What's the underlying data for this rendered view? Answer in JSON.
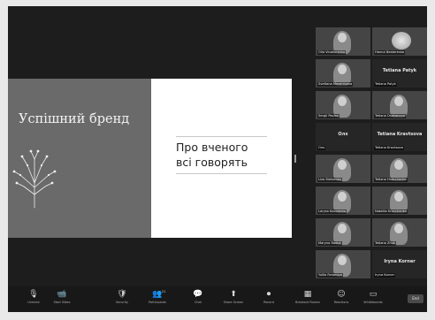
{
  "slide": {
    "title": "Успішний бренд",
    "body_lines": [
      "Про вченого",
      "всі говорять"
    ]
  },
  "gallery": {
    "tiles": [
      {
        "kind": "video",
        "label": "Olia Vinokurenko"
      },
      {
        "kind": "video",
        "label": "Hanna Nesterenko"
      },
      {
        "kind": "video",
        "label": "Svetlana Mezentseva"
      },
      {
        "kind": "name",
        "display": "Tetiana Patyk",
        "label": "Tetiana Patyk"
      },
      {
        "kind": "video",
        "label": "Sergii Pavlov"
      },
      {
        "kind": "video",
        "label": "Tetiana Osakanova"
      },
      {
        "kind": "name",
        "display": "Олх",
        "label": "Олх"
      },
      {
        "kind": "name",
        "display": "Tetiana Kravtsova",
        "label": "Tetiana Kravtsova"
      },
      {
        "kind": "video",
        "label": "Liza Stetsenko"
      },
      {
        "kind": "video",
        "label": "Tetiana Hrabchenko"
      },
      {
        "kind": "video",
        "label": "Larysa Kovalenko"
      },
      {
        "kind": "video",
        "label": "Nataliia Kravchenko"
      },
      {
        "kind": "video",
        "label": "Maryna Radok"
      },
      {
        "kind": "video",
        "label": "Tetiana Zhuk"
      },
      {
        "kind": "video",
        "label": "Yuliia Fedorova"
      },
      {
        "kind": "name",
        "display": "Iryna Korner",
        "label": "Iryna Korner"
      }
    ],
    "more": "⌄"
  },
  "toolbar": {
    "items": [
      {
        "icon": "🎙",
        "label": "Unmute",
        "icon_name": "microphone-icon"
      },
      {
        "icon": "📹",
        "label": "Start Video",
        "icon_name": "video-camera-icon"
      },
      {
        "icon": "🛡",
        "label": "Security",
        "icon_name": "shield-icon"
      },
      {
        "icon": "👥",
        "label": "Participants",
        "badge": "21",
        "icon_name": "participants-icon"
      },
      {
        "icon": "💬",
        "label": "Chat",
        "icon_name": "chat-icon"
      },
      {
        "icon": "⬆",
        "label": "Share Screen",
        "icon_name": "share-screen-icon"
      },
      {
        "icon": "⏺",
        "label": "Record",
        "icon_name": "record-icon"
      },
      {
        "icon": "▦",
        "label": "Breakout Rooms",
        "icon_name": "breakout-rooms-icon"
      },
      {
        "icon": "☺",
        "label": "Reactions",
        "icon_name": "reactions-icon"
      },
      {
        "icon": "▭",
        "label": "Whiteboards",
        "icon_name": "whiteboard-icon"
      }
    ],
    "end_label": "End"
  }
}
